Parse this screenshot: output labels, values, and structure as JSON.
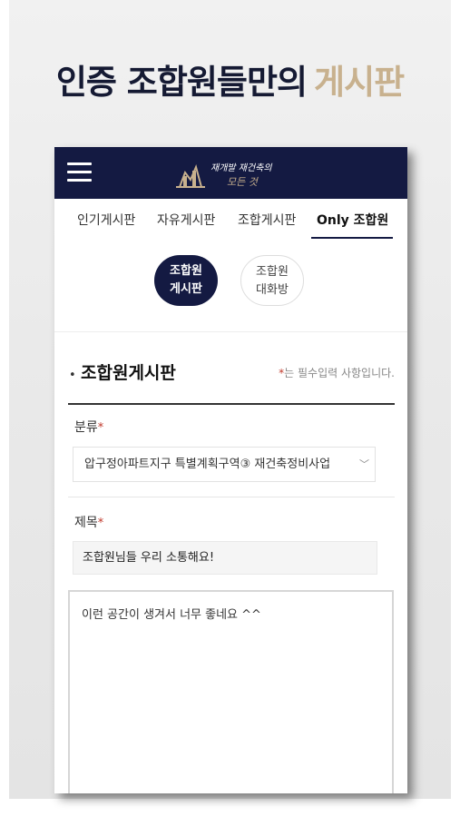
{
  "promo": {
    "headline_main": "인증 조합원들만의",
    "headline_highlight": "게시판",
    "colors": {
      "dark": "#151a33",
      "gold": "#c8b18e"
    }
  },
  "app": {
    "brand_color": "#141a42",
    "menu_icon": "hamburger-menu-icon",
    "logo_line1": "재개발 재건축의",
    "logo_line2": "모든 것",
    "tabs": [
      {
        "label": "인기게시판",
        "active": false
      },
      {
        "label": "자유게시판",
        "active": false
      },
      {
        "label": "조합게시판",
        "active": false
      },
      {
        "label": "Only 조합원",
        "active": true
      }
    ],
    "subnav": [
      {
        "line1": "조합원",
        "line2": "게시판",
        "active": true
      },
      {
        "line1": "조합원",
        "line2": "대화방",
        "active": false
      }
    ]
  },
  "form": {
    "title": "조합원게시판",
    "required_star": "*",
    "required_note": "는 필수입력 사항입니다.",
    "category_label": "분류",
    "category_value": "압구정아파트지구 특별계획구역③ 재건축정비사업",
    "subject_label": "제목",
    "subject_value": "조합원님들 우리 소통해요!",
    "body_value": "이런 공간이 생겨서 너무 좋네요 ^^"
  }
}
